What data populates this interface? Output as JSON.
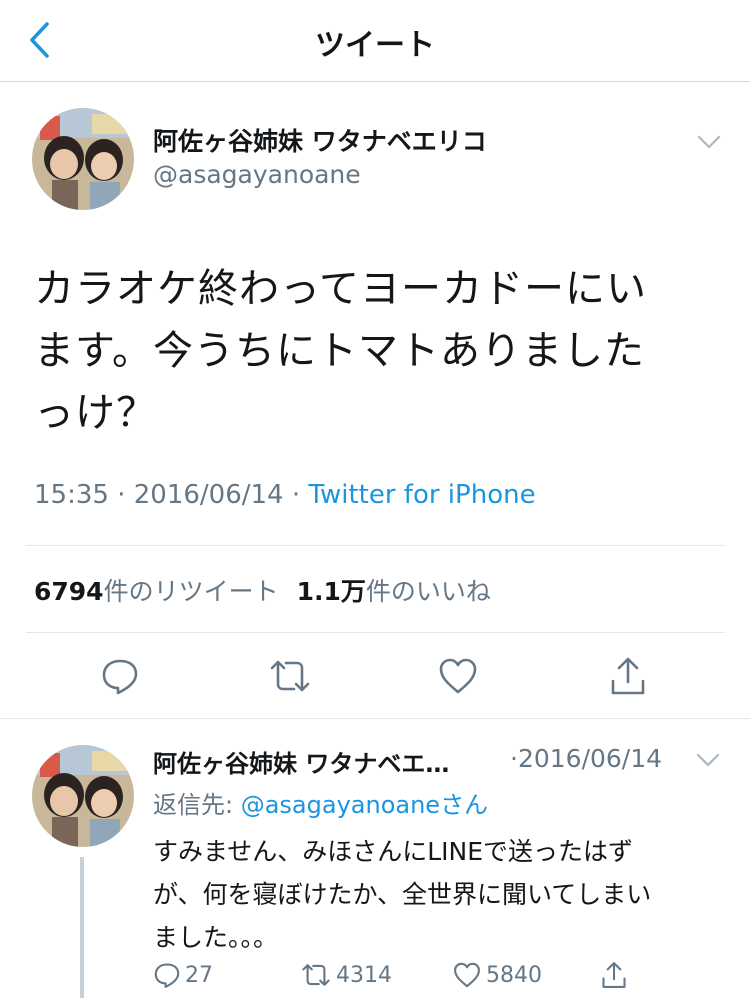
{
  "nav": {
    "title": "ツイート",
    "back_icon": "chevron-left-icon"
  },
  "colors": {
    "accent": "#1b95e0",
    "text": "#14171a",
    "secondary": "#657786",
    "divider": "#e1e8ed"
  },
  "tweet": {
    "author_name": "阿佐ヶ谷姉妹 ワタナベエリコ",
    "handle": "@asagayanoane",
    "text_lines": [
      "カラオケ終わってヨーカドーにい",
      "ます。今うちにトマトありました",
      "っけ？"
    ],
    "time": "15:35",
    "sep1": " · ",
    "date": "2016/06/14",
    "sep2": " · ",
    "source": "Twitter for iPhone",
    "retweet_count": "6794",
    "retweet_label": "件のリツイート",
    "like_count": "1.1万",
    "like_label": "件のいいね"
  },
  "actions": [
    "reply-icon",
    "retweet-icon",
    "like-icon",
    "share-icon"
  ],
  "reply": {
    "author_name": "阿佐ヶ谷姉妹 ワタナベエ…",
    "date": "·2016/06/14",
    "reply_to_label": "返信先: ",
    "reply_to_handle": "@asagayanoane",
    "reply_to_suffix": "さん",
    "text_lines": [
      "すみません、みほさんにLINEで送ったはず",
      "が、何を寝ぼけたか、全世界に聞いてしまい",
      "ました。。。"
    ],
    "reply_count": "27",
    "retweet_count": "4314",
    "like_count": "5840"
  }
}
